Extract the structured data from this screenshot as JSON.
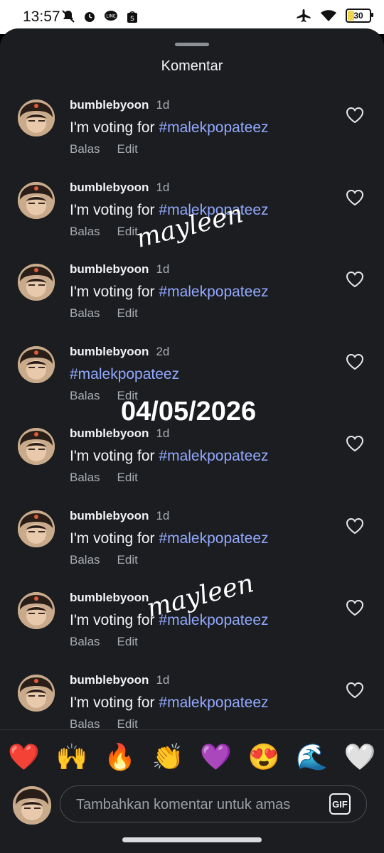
{
  "status_bar": {
    "time": "13:57",
    "battery": "30",
    "icons": [
      "mute-icon",
      "alarm-icon",
      "line-app-icon",
      "shopee-icon",
      "airplane-icon",
      "wifi-icon",
      "battery-icon"
    ]
  },
  "sheet": {
    "title": "Komentar"
  },
  "comments": [
    {
      "username": "bumblebyoon",
      "time": "1d",
      "text": "I'm voting for ",
      "hashtag": "#malekpopateez",
      "reply": "Balas",
      "edit": "Edit"
    },
    {
      "username": "bumblebyoon",
      "time": "1d",
      "text": "I'm voting for ",
      "hashtag": "#malekpopateez",
      "reply": "Balas",
      "edit": "Edit"
    },
    {
      "username": "bumblebyoon",
      "time": "1d",
      "text": "I'm voting for ",
      "hashtag": "#malekpopateez",
      "reply": "Balas",
      "edit": "Edit"
    },
    {
      "username": "bumblebyoon",
      "time": "2d",
      "text": "",
      "hashtag": "#malekpopateez",
      "reply": "Balas",
      "edit": "Edit"
    },
    {
      "username": "bumblebyoon",
      "time": "1d",
      "text": "I'm voting for ",
      "hashtag": "#malekpopateez",
      "reply": "Balas",
      "edit": "Edit"
    },
    {
      "username": "bumblebyoon",
      "time": "1d",
      "text": "I'm voting for ",
      "hashtag": "#malekpopateez",
      "reply": "Balas",
      "edit": "Edit"
    },
    {
      "username": "bumblebyoon",
      "time": "",
      "text": "I'm voting for ",
      "hashtag": "#malekpopateez",
      "reply": "Balas",
      "edit": "Edit"
    },
    {
      "username": "bumblebyoon",
      "time": "1d",
      "text": "I'm voting for ",
      "hashtag": "#malekpopateez",
      "reply": "Balas",
      "edit": "Edit"
    }
  ],
  "emoji_bar": [
    "❤️",
    "🙌",
    "🔥",
    "👏",
    "💜",
    "😍",
    "🌊",
    "🤍"
  ],
  "composer": {
    "placeholder": "Tambahkan komentar untuk amas",
    "gif_label": "GIF"
  },
  "overlays": {
    "watermark_1": "mayleen",
    "watermark_2": "mayleen",
    "date_stamp": "04/05/2026"
  },
  "colors": {
    "background": "#1b1d20",
    "hashtag": "#93a9ff",
    "muted": "#a8adb3"
  }
}
